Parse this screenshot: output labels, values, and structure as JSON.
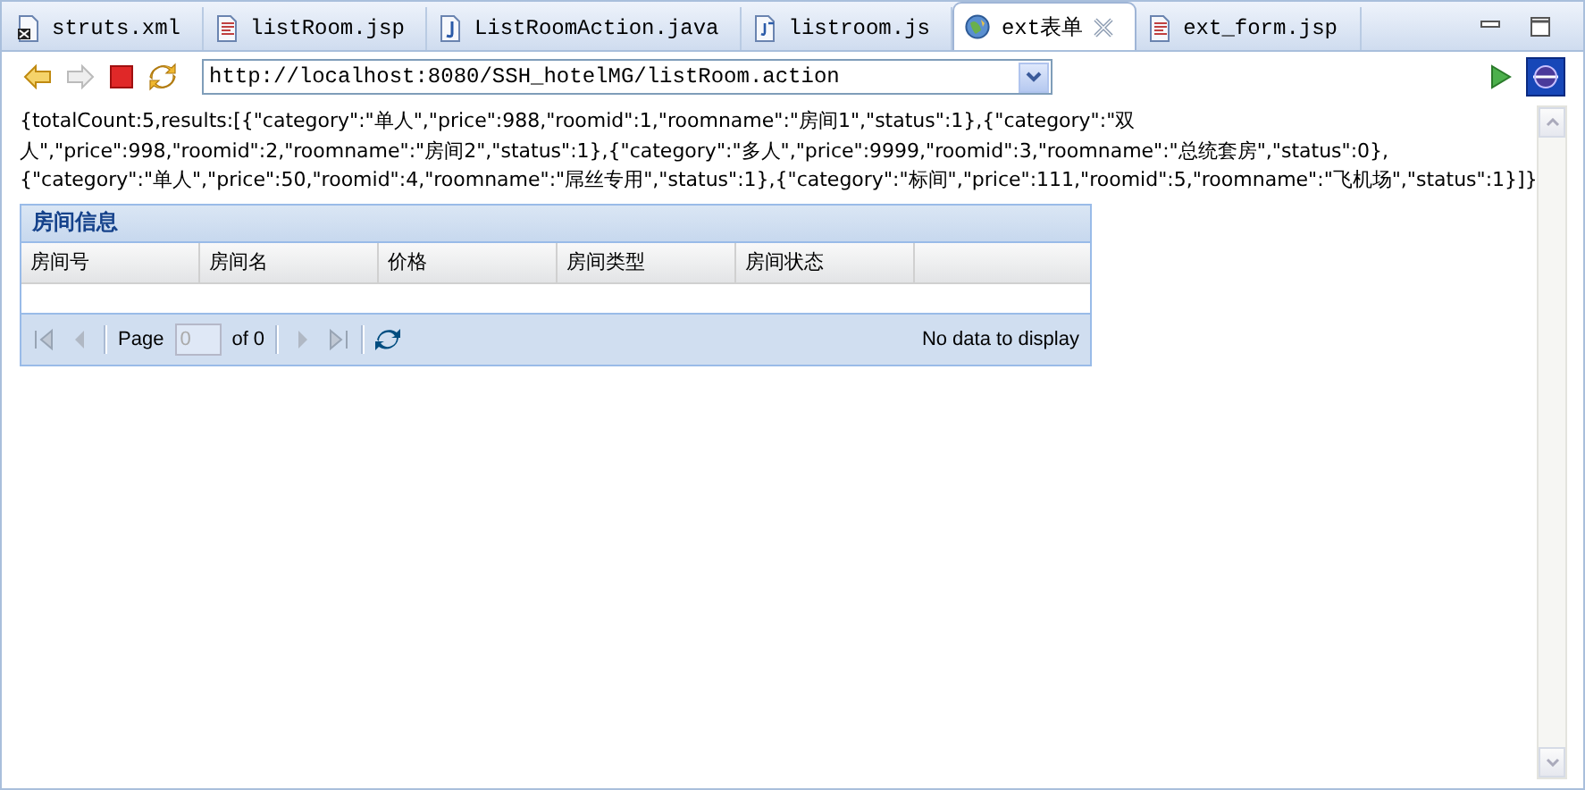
{
  "tabs": [
    {
      "label": "struts.xml",
      "kind": "xml",
      "selected": false
    },
    {
      "label": "listRoom.jsp",
      "kind": "jsp",
      "selected": false
    },
    {
      "label": "ListRoomAction.java",
      "kind": "java",
      "selected": false
    },
    {
      "label": "listroom.js",
      "kind": "js",
      "selected": false
    },
    {
      "label": "ext表单",
      "kind": "web",
      "selected": true
    },
    {
      "label": "ext_form.jsp",
      "kind": "jsp",
      "selected": false
    }
  ],
  "browser": {
    "url": "http://localhost:8080/SSH_hotelMG/listRoom.action"
  },
  "response_lines": [
    "{totalCount:5,results:[{\"category\":\"单人\",\"price\":988,\"roomid\":1,\"roomname\":\"房间1\",\"status\":1},{\"category\":\"双",
    "人\",\"price\":998,\"roomid\":2,\"roomname\":\"房间2\",\"status\":1},{\"category\":\"多人\",\"price\":9999,\"roomid\":3,\"roomname\":\"总统套房\",\"status\":0},",
    "{\"category\":\"单人\",\"price\":50,\"roomid\":4,\"roomname\":\"屌丝专用\",\"status\":1},{\"category\":\"标间\",\"price\":111,\"roomid\":5,\"roomname\":\"飞机场\",\"status\":1}]}"
  ],
  "grid": {
    "title": "房间信息",
    "columns": [
      "房间号",
      "房间名",
      "价格",
      "房间类型",
      "房间状态"
    ],
    "pager": {
      "buttons": [
        {
          "kind": "first",
          "disabled": true
        },
        {
          "kind": "prev",
          "disabled": true
        },
        {
          "kind": "page_label",
          "text": "Page"
        },
        {
          "kind": "page_field",
          "value": "0"
        },
        {
          "kind": "page_count",
          "text": "of 0"
        },
        {
          "kind": "next",
          "disabled": true
        },
        {
          "kind": "last",
          "disabled": true
        },
        {
          "kind": "refresh",
          "disabled": false
        }
      ],
      "status": "No data to display"
    }
  }
}
